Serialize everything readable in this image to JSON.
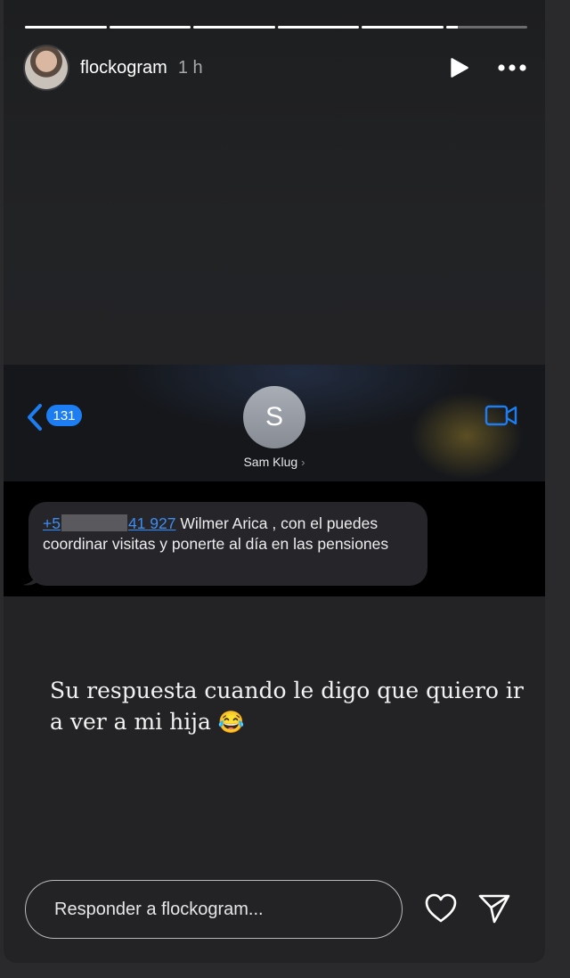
{
  "story": {
    "progress": [
      1,
      1,
      1,
      1,
      1,
      0.15
    ],
    "username": "flockogram",
    "time": "1 h"
  },
  "screenshot": {
    "back_badge": "131",
    "contact_initial": "S",
    "contact_name": "Sam Klug",
    "message": {
      "phone_prefix": "+5",
      "phone_suffix": "41 927",
      "text": " Wilmer Arica , con el puedes coordinar visitas y ponerte al día en las pensiones"
    }
  },
  "caption": {
    "text": "Su respuesta cuando le digo que quiero ir a ver a mi hija",
    "emoji": "😂"
  },
  "reply": {
    "placeholder": "Responder a flockogram..."
  },
  "colors": {
    "accent": "#1c7ef2",
    "link": "#3b8ef5"
  },
  "icons": [
    "play-icon",
    "more-icon",
    "chevron-left-icon",
    "video-camera-icon",
    "heart-icon",
    "send-icon"
  ]
}
